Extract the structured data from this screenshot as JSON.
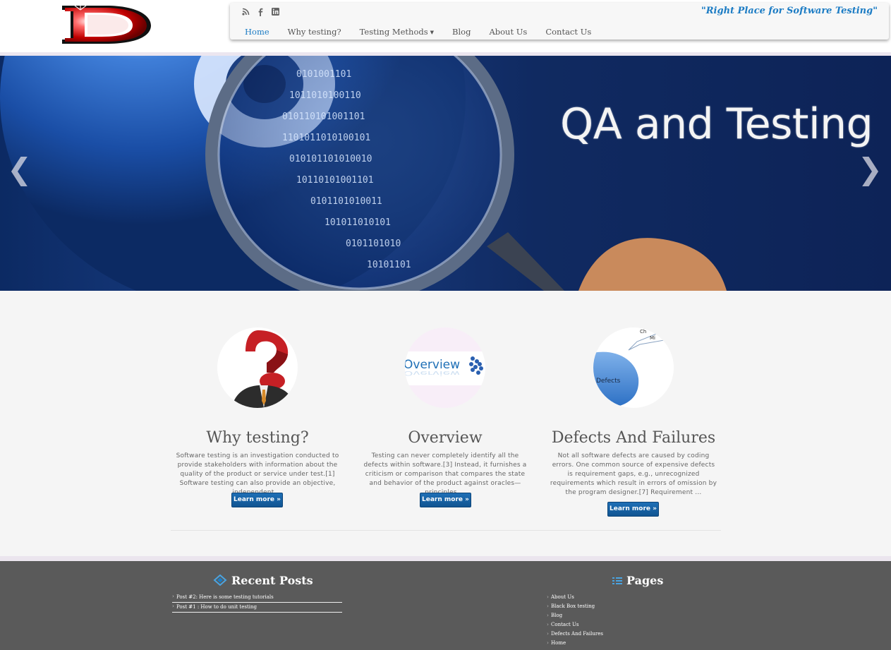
{
  "header": {
    "tagline": "\"Right Place for Software Testing\"",
    "logo_letter": "D",
    "social": [
      "rss-icon",
      "facebook-icon",
      "linkedin-icon"
    ]
  },
  "nav": {
    "items": [
      {
        "label": "Home",
        "active": true
      },
      {
        "label": "Why testing?"
      },
      {
        "label": "Testing Methods",
        "dropdown": true
      },
      {
        "label": "Blog"
      },
      {
        "label": "About Us"
      },
      {
        "label": "Contact Us"
      }
    ]
  },
  "slider": {
    "title": "QA and Testing",
    "prev": "❮",
    "next": "❯"
  },
  "features": [
    {
      "title": "Why testing?",
      "text": "Software testing is an investigation conducted to provide stakeholders with information about the quality of the product or service under test.[1] Software testing can also provide an objective, independent ...",
      "button": "Learn more »"
    },
    {
      "title": "Overview",
      "image_text": "Overview",
      "text": "Testing can never completely identify all the defects within software.[3] Instead, it furnishes a criticism or comparison that compares the state and behavior of the product against oracles—principles ...",
      "button": "Learn more »"
    },
    {
      "title": "Defects And Failures",
      "image_text": "Defects",
      "image_text2": "Ch",
      "image_text3": "Mi",
      "text": "Not all software defects are caused by coding errors. One common source of expensive defects is requirement gaps, e.g., unrecognized requirements which result in errors of omission by the program designer.[7] Requirement ...",
      "button": "Learn more »"
    }
  ],
  "footer": {
    "recent_posts": {
      "title": "Recent Posts",
      "posts": [
        "Post #2: Here is some testing tutorials",
        "Post #1 : How to do unit testing"
      ]
    },
    "pages": {
      "title": "Pages",
      "links": [
        "About Us",
        "Black Box testing",
        "Blog",
        "Contact Us",
        "Defects And Failures",
        "Home"
      ]
    }
  },
  "colors": {
    "accent": "#1c7cc4",
    "button": "#1666a8",
    "footer_bg": "#5a5a5a"
  }
}
